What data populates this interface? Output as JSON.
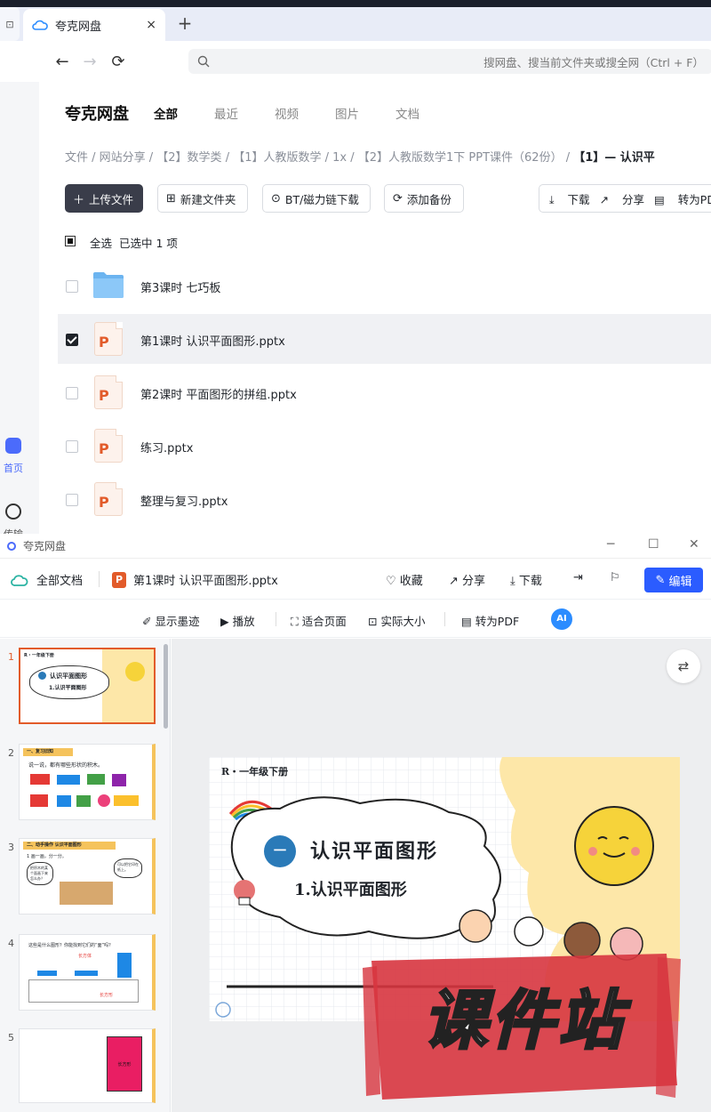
{
  "browser": {
    "tab_title": "夸克网盘",
    "tab_close": "×",
    "new_tab": "+",
    "back": "←",
    "forward": "→",
    "reload": "⟳",
    "search_placeholder": "搜网盘、搜当前文件夹或搜全网（Ctrl + F）"
  },
  "sidebar": {
    "items": [
      {
        "label": "首页",
        "icon": "home-icon"
      },
      {
        "label": "传输",
        "icon": "transfer-icon"
      }
    ]
  },
  "header": {
    "brand": "夸克网盘",
    "tabs": [
      "全部",
      "最近",
      "视频",
      "图片",
      "文档"
    ]
  },
  "breadcrumb": {
    "path": "文件 / 网站分享 / 【2】数学类 / 【1】人教版数学 / 1x / 【2】人教版数学1下 PPT课件（62份） / ",
    "current": "【1】— 认识平"
  },
  "actions": {
    "upload": "上传文件",
    "new_folder": "新建文件夹",
    "bt": "BT/磁力链下载",
    "backup": "添加备份",
    "download": "下载",
    "share": "分享",
    "to_pdf": "转为PDF"
  },
  "selection": {
    "select_all": "全选",
    "selected": "已选中  1  项"
  },
  "files": [
    {
      "name": "第3课时 七巧板",
      "type": "folder",
      "checked": false
    },
    {
      "name": "第1课时 认识平面图形.pptx",
      "type": "pptx",
      "checked": true
    },
    {
      "name": "第2课时 平面图形的拼组.pptx",
      "type": "pptx",
      "checked": false
    },
    {
      "name": "练习.pptx",
      "type": "pptx",
      "checked": false
    },
    {
      "name": "整理与复习.pptx",
      "type": "pptx",
      "checked": false
    }
  ],
  "viewer": {
    "window_title": "夸克网盘",
    "all_docs": "全部文档",
    "file_name": "第1课时 认识平面图形.pptx",
    "favorite": "收藏",
    "share": "分享",
    "download": "下载",
    "edit": "编辑",
    "tools": {
      "ink": "显示墨迹",
      "play": "播放",
      "fit": "适合页面",
      "actual": "实际大小",
      "to_pdf": "转为PDF",
      "ai": "AI"
    },
    "slide_numbers": [
      "1",
      "2",
      "3",
      "4",
      "5"
    ],
    "thumb_texts": {
      "t1_top": "R・一年级下册",
      "t1_title": "认识平面图形",
      "t1_sub": "1.认识平面图形",
      "t2_header": "一、复习旧知",
      "t2_text": "说一说，都有哪些形状的积木。",
      "t3_header": "二、动手操作  认识平面图形",
      "t3_q": "1 画一画，分一分。",
      "t3_b1": "把积木的某个面画下来怎么办？",
      "t3_b2": "可以把它印在纸上。",
      "t4_q": "这些是什么图形？你能找到它们的“面”吗？",
      "t4_l1": "长方体",
      "t4_l2": "长方形",
      "t5_label": "长方形"
    },
    "slide": {
      "grade": "R・一年级下册",
      "unit_num": "一",
      "title": "认识平面图形",
      "subtitle": "1.认识平面图形"
    },
    "watermark": "课件站"
  },
  "colors": {
    "accent": "#2b5cff",
    "ppt": "#e25b2a",
    "slide_yellow": "#fde7a8",
    "unit_circle": "#2a7ab8"
  }
}
